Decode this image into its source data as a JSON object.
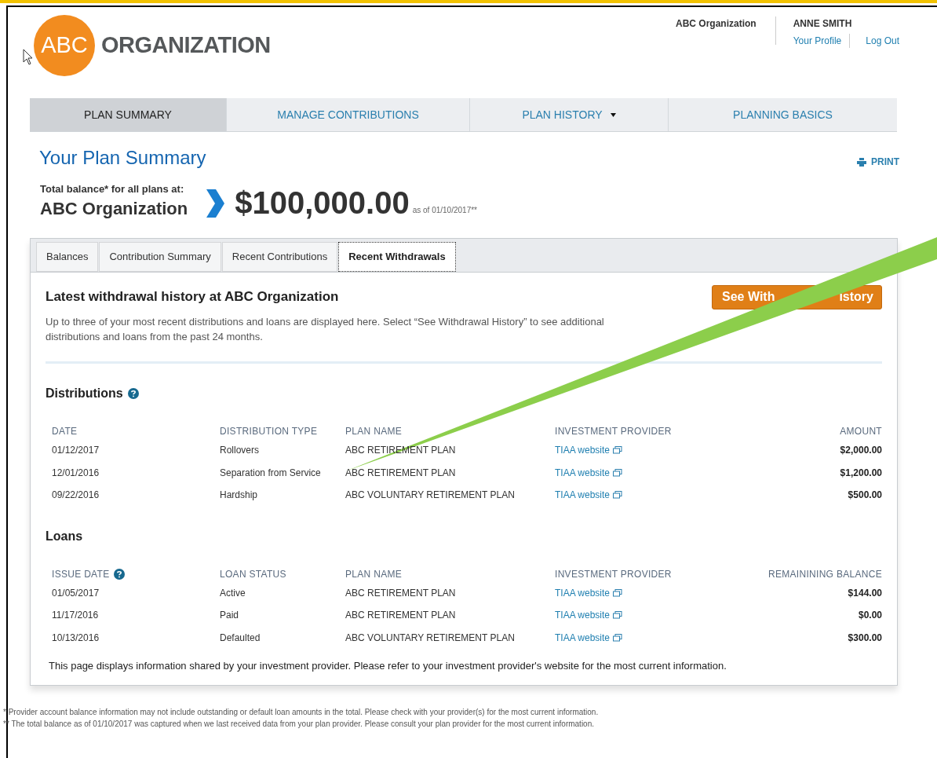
{
  "header": {
    "logo_mark": "ABC",
    "logo_name": "ORGANIZATION",
    "organization": "ABC Organization",
    "user": "ANNE SMITH",
    "links": [
      "Your Profile",
      "Log Out"
    ]
  },
  "nav": [
    {
      "label": "PLAN SUMMARY",
      "selected": true,
      "has_menu": false
    },
    {
      "label": "MANAGE CONTRIBUTIONS",
      "selected": false,
      "has_menu": false
    },
    {
      "label": "PLAN HISTORY",
      "selected": false,
      "has_menu": true
    },
    {
      "label": "PLANNING BASICS",
      "selected": false,
      "has_menu": false
    }
  ],
  "page_title": "Your Plan Summary",
  "print": "PRINT",
  "balance": {
    "label": "Total balance* for all plans at:",
    "organization": "ABC Organization",
    "amount": "$100,000.00",
    "as_of": "as of 01/10/2017**"
  },
  "tabs": [
    {
      "label": "Balances",
      "selected": false
    },
    {
      "label": "Contribution Summary",
      "selected": false
    },
    {
      "label": "Recent Contributions",
      "selected": false
    },
    {
      "label": "Recent Withdrawals",
      "selected": true
    }
  ],
  "panel": {
    "title": "Latest withdrawal history at ABC Organization",
    "description": "Up to three of your most recent distributions and loans are displayed here. Select “See Withdrawal History” to see additional distributions and loans from the past 24 months.",
    "button": [
      "See With",
      "istory"
    ]
  },
  "sections": [
    {
      "title": "Distributions",
      "help": true,
      "columns": [
        {
          "label": "DATE",
          "kind": "text",
          "help": false
        },
        {
          "label": "DISTRIBUTION TYPE",
          "kind": "text",
          "help": false
        },
        {
          "label": "PLAN NAME",
          "kind": "text",
          "help": false
        },
        {
          "label": "INVESTMENT PROVIDER",
          "kind": "link",
          "help": false
        },
        {
          "label": "AMOUNT",
          "kind": "amount",
          "help": false
        }
      ],
      "rows": [
        [
          "01/12/2017",
          "Rollovers",
          "ABC RETIREMENT PLAN",
          "TIAA website",
          "$2,000.00"
        ],
        [
          "12/01/2016",
          "Separation from Service",
          "ABC RETIREMENT PLAN",
          "TIAA website",
          "$1,200.00"
        ],
        [
          "09/22/2016",
          "Hardship",
          "ABC VOLUNTARY RETIREMENT PLAN",
          "TIAA website",
          "$500.00"
        ]
      ]
    },
    {
      "title": "Loans",
      "help": false,
      "columns": [
        {
          "label": "ISSUE DATE",
          "kind": "text",
          "help": true
        },
        {
          "label": "LOAN STATUS",
          "kind": "text",
          "help": false
        },
        {
          "label": "PLAN NAME",
          "kind": "text",
          "help": false
        },
        {
          "label": "INVESTMENT PROVIDER",
          "kind": "link",
          "help": false
        },
        {
          "label": "REMAININING BALANCE",
          "kind": "amount",
          "help": false
        }
      ],
      "rows": [
        [
          "01/05/2017",
          "Active",
          "ABC RETIREMENT PLAN",
          "TIAA website",
          "$144.00"
        ],
        [
          "11/17/2016",
          "Paid",
          "ABC RETIREMENT PLAN",
          "TIAA website",
          "$0.00"
        ],
        [
          "10/13/2016",
          "Defaulted",
          "ABC VOLUNTARY RETIREMENT PLAN",
          "TIAA website",
          "$300.00"
        ]
      ]
    }
  ],
  "note": "This page displays information shared by your investment provider. Please refer to your investment provider's website for the most current information.",
  "footnotes": [
    "* Provider account balance information may not include outstanding or default loan amounts in the total. Please check with your provider(s) for the most current information.",
    "** The total balance as of 01/10/2017 was captured when we last received data from your plan provider. Please consult your plan provider for the most current information."
  ]
}
